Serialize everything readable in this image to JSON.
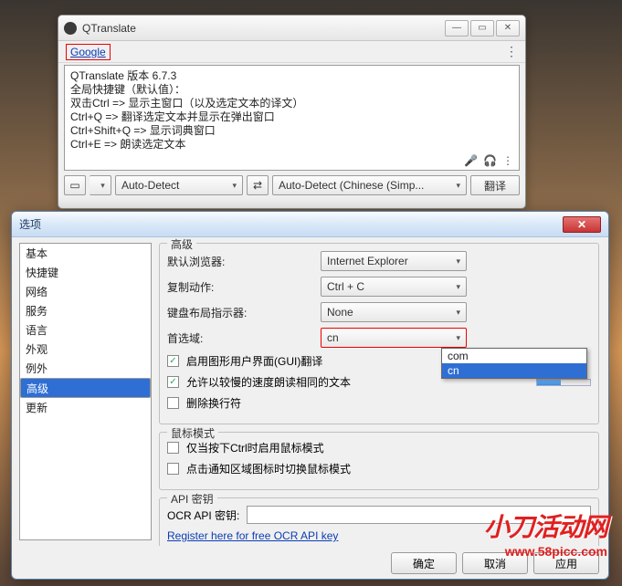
{
  "main": {
    "title": "QTranslate",
    "google_link": "Google",
    "text_lines": [
      "QTranslate 版本 6.7.3",
      "",
      "全局快捷键（默认值）：",
      "双击Ctrl => 显示主窗口（以及选定文本的译文）",
      "Ctrl+Q => 翻译选定文本并显示在弹出窗口",
      "Ctrl+Shift+Q => 显示词典窗口",
      "Ctrl+E => 朗读选定文本"
    ],
    "src_lang": "Auto-Detect",
    "dst_lang": "Auto-Detect (Chinese (Simp...",
    "translate_btn": "翻译"
  },
  "opts": {
    "title": "选项",
    "list": [
      "基本",
      "快捷键",
      "网络",
      "服务",
      "语言",
      "外观",
      "例外",
      "高级",
      "更新"
    ],
    "list_selected": 7,
    "advanced": {
      "legend": "高级",
      "browser_lbl": "默认浏览器:",
      "browser_val": "Internet Explorer",
      "copy_lbl": "复制动作:",
      "copy_val": "Ctrl + C",
      "kbd_lbl": "键盘布局指示器:",
      "kbd_val": "None",
      "domain_lbl": "首选域:",
      "domain_val": "cn",
      "domain_opts": [
        "com",
        "cn"
      ],
      "cb1": "启用图形用户界面(GUI)翻译",
      "cb2": "允许以较慢的速度朗读相同的文本",
      "cb3": "删除换行符"
    },
    "mouse": {
      "legend": "鼠标模式",
      "cb1": "仅当按下Ctrl时启用鼠标模式",
      "cb2": "点击通知区域图标时切换鼠标模式"
    },
    "api": {
      "legend": "API 密钥",
      "lbl": "OCR API 密钥:",
      "link": "Register here for free OCR API key"
    },
    "buttons": {
      "ok": "确定",
      "cancel": "取消",
      "apply": "应用"
    }
  },
  "watermark": {
    "big": "小刀活动网",
    "url": "www.58picc.com"
  }
}
